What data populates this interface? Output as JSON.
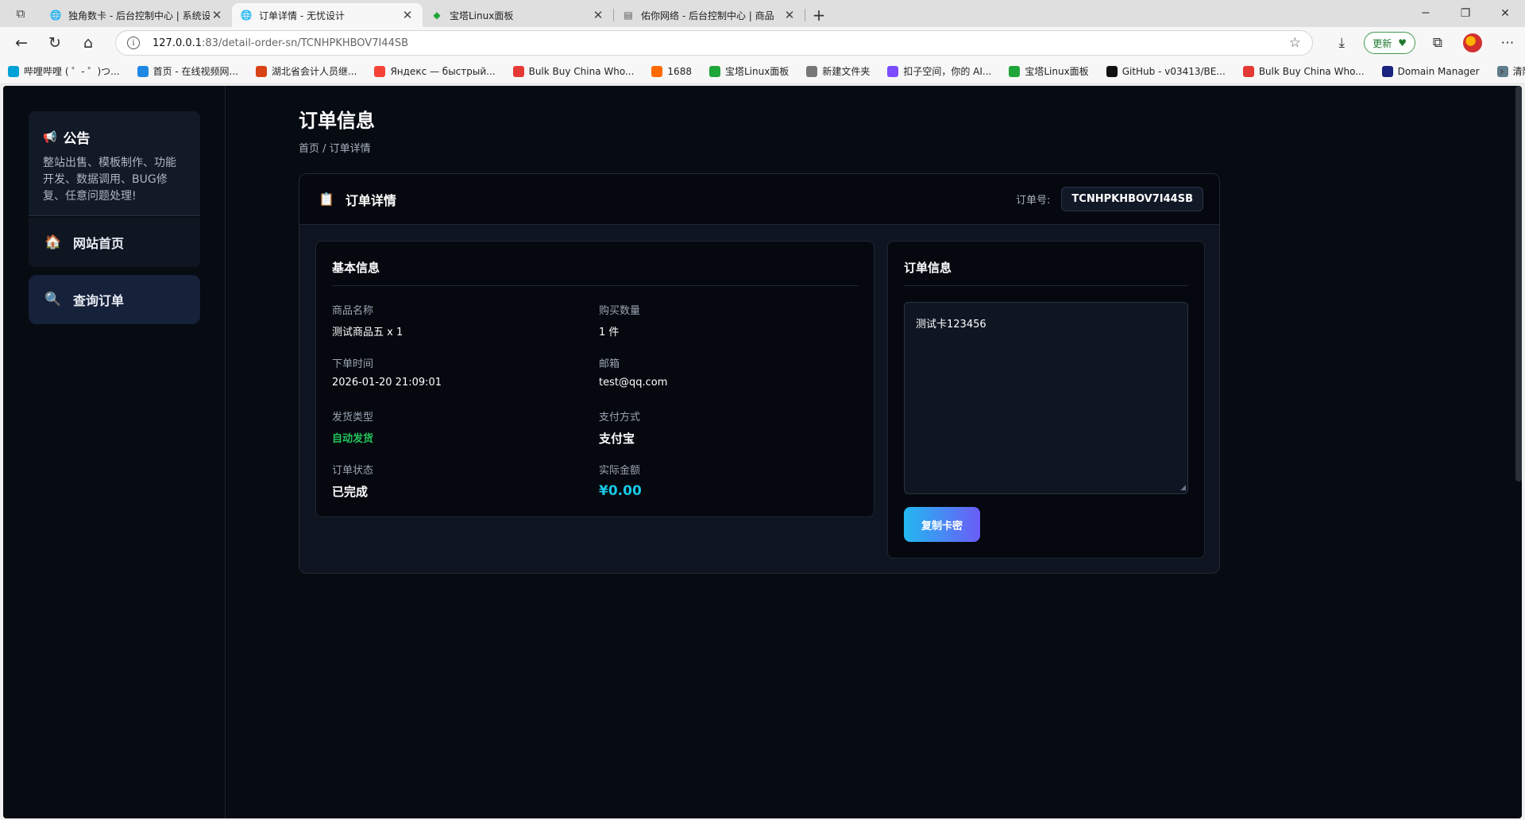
{
  "browser": {
    "tabs": [
      {
        "title": "独角数卡 - 后台控制中心 | 系统设",
        "active": false,
        "icon": "globe-icon"
      },
      {
        "title": "订单详情 - 无忧设计",
        "active": true,
        "icon": "globe-icon"
      },
      {
        "title": "宝塔Linux面板",
        "active": false,
        "icon": "shield-icon"
      },
      {
        "title": "佑你网络 - 后台控制中心 | 商品",
        "active": false,
        "icon": "page-icon"
      }
    ],
    "url_host": "127.0.0.1",
    "url_path": ":83/detail-order-sn/TCNHPKHBOV7I44SB",
    "update_label": "更新",
    "bookmarks": [
      {
        "label": "哔哩哔哩 ( ゜- ゜)つ...",
        "color": "#00a1d6"
      },
      {
        "label": "首页 - 在线视频网...",
        "color": "#1e88e5"
      },
      {
        "label": "湖北省会计人员继...",
        "color": "#d84315"
      },
      {
        "label": "Яндекс — быстрый...",
        "color": "#f44336"
      },
      {
        "label": "Bulk Buy China Who...",
        "color": "#e53935"
      },
      {
        "label": "1688",
        "color": "#ff6a00"
      },
      {
        "label": "宝塔Linux面板",
        "color": "#20a53a"
      },
      {
        "label": "新建文件夹",
        "color": "#777777"
      },
      {
        "label": "扣子空间，你的 AI...",
        "color": "#7c4dff"
      },
      {
        "label": "宝塔Linux面板",
        "color": "#20a53a"
      },
      {
        "label": "GitHub - v03413/BE...",
        "color": "#111111"
      },
      {
        "label": "Bulk Buy China Who...",
        "color": "#e53935"
      },
      {
        "label": "Domain Manager",
        "color": "#1a237e"
      },
      {
        "label": "清除缓存",
        "color": "#607d8b"
      }
    ]
  },
  "sidebar": {
    "notice_title": "公告",
    "notice_text": "整站出售、模板制作、功能开发、数据调用、BUG修复、任意问题处理!",
    "menu": [
      {
        "label": "网站首页",
        "icon": "house-icon"
      },
      {
        "label": "查询订单",
        "icon": "magnifier-icon"
      }
    ]
  },
  "main": {
    "page_title": "订单信息",
    "breadcrumb": {
      "home": "首页",
      "sep": " / ",
      "current": "订单详情"
    },
    "order_card": {
      "title": "订单详情",
      "sn_label": "订单号:",
      "sn_value": "TCNHPKHBOV7I44SB"
    },
    "basic_info": {
      "title": "基本信息",
      "fields": [
        {
          "label": "商品名称",
          "value": "测试商品五 x 1"
        },
        {
          "label": "购买数量",
          "value": "1 件"
        },
        {
          "label": "下单时间",
          "value": "2026-01-20 21:09:01"
        },
        {
          "label": "邮箱",
          "value": "test@qq.com"
        },
        {
          "label": "发货类型",
          "value": "自动发货"
        },
        {
          "label": "支付方式",
          "value": "支付宝"
        },
        {
          "label": "订单状态",
          "value": "已完成"
        },
        {
          "label": "实际金额",
          "value": "¥0.00"
        }
      ]
    },
    "card_info": {
      "title": "订单信息",
      "card_content": "测试卡123456",
      "copy_button": "复制卡密"
    }
  },
  "colors": {
    "page_bg": "#070b12",
    "accent_green": "#22c55e",
    "accent_cyan": "#19c8e8",
    "button_gradient_start": "#22b8f0",
    "button_gradient_end": "#6b5cf6"
  }
}
